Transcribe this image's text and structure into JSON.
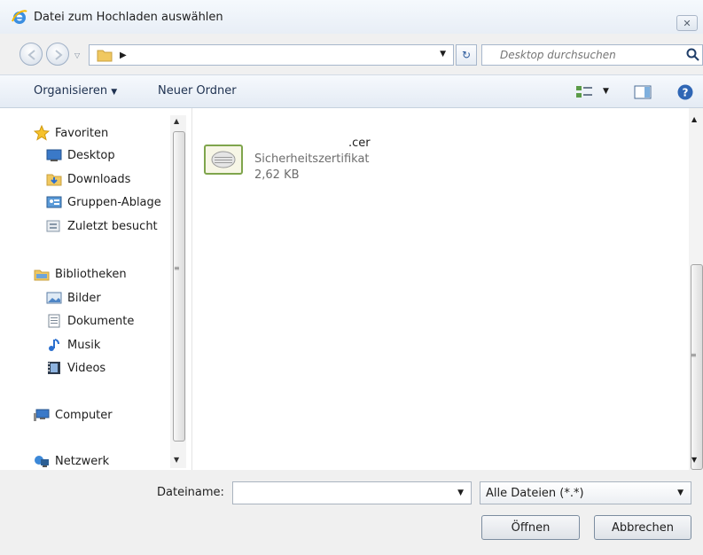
{
  "window": {
    "title": "Datei zum Hochladen auswählen"
  },
  "address": {
    "search_placeholder": "Desktop durchsuchen"
  },
  "toolbar": {
    "organize_label": "Organisieren",
    "new_folder_label": "Neuer Ordner"
  },
  "nav": {
    "favorites": {
      "label": "Favoriten",
      "icon": "star-icon"
    },
    "favorites_items": [
      {
        "label": "Desktop",
        "icon": "desktop-icon"
      },
      {
        "label": "Downloads",
        "icon": "downloads-folder-icon"
      },
      {
        "label": "Gruppen-Ablage",
        "icon": "shared-folder-icon"
      },
      {
        "label": "Zuletzt besucht",
        "icon": "recent-places-icon"
      }
    ],
    "libraries": {
      "label": "Bibliotheken",
      "icon": "library-icon"
    },
    "libraries_items": [
      {
        "label": "Bilder",
        "icon": "pictures-icon"
      },
      {
        "label": "Dokumente",
        "icon": "documents-icon"
      },
      {
        "label": "Musik",
        "icon": "music-icon"
      },
      {
        "label": "Videos",
        "icon": "videos-icon"
      }
    ],
    "computer": {
      "label": "Computer",
      "icon": "computer-icon"
    },
    "network": {
      "label": "Netzwerk",
      "icon": "network-icon"
    }
  },
  "file": {
    "name": ".cer",
    "type": "Sicherheitszertifikat",
    "size": "2,62 KB",
    "icon": "certificate-icon"
  },
  "bottom": {
    "filename_label": "Dateiname:",
    "filename_value": "",
    "filter_selected": "Alle Dateien (*.*)",
    "open_label": "Öffnen",
    "cancel_label": "Abbrechen"
  }
}
